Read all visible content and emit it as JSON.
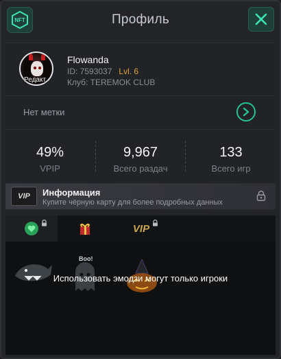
{
  "header": {
    "nft_label": "NFT",
    "title": "Профиль",
    "close_icon": "close-x"
  },
  "profile": {
    "avatar_label": "Редакт.",
    "name": "Flowanda",
    "id_text": "ID: 7593037",
    "level": "Lvl. 6",
    "club": "Клуб: TEREMOK CLUB",
    "tag_text": "Нет метки"
  },
  "stats": [
    {
      "value": "49%",
      "label": "VPIP"
    },
    {
      "value": "9,967",
      "label": "Всего раздач"
    },
    {
      "value": "133",
      "label": "Всего игр"
    }
  ],
  "info": {
    "badge": "VIP",
    "title": "Информация",
    "subtitle": "Купите чёрную карту для более подробных данных"
  },
  "emoji": {
    "tabs": [
      "green-heart-emoji",
      "gift-emoji",
      "vip-emoji"
    ],
    "vip_tab_label": "VIP",
    "boo_label": "Boo!",
    "notice": "Использовать эмодзи могут только игроки"
  },
  "colors": {
    "accent": "#27c28f",
    "level": "#e0a13a",
    "background": "#232428"
  }
}
